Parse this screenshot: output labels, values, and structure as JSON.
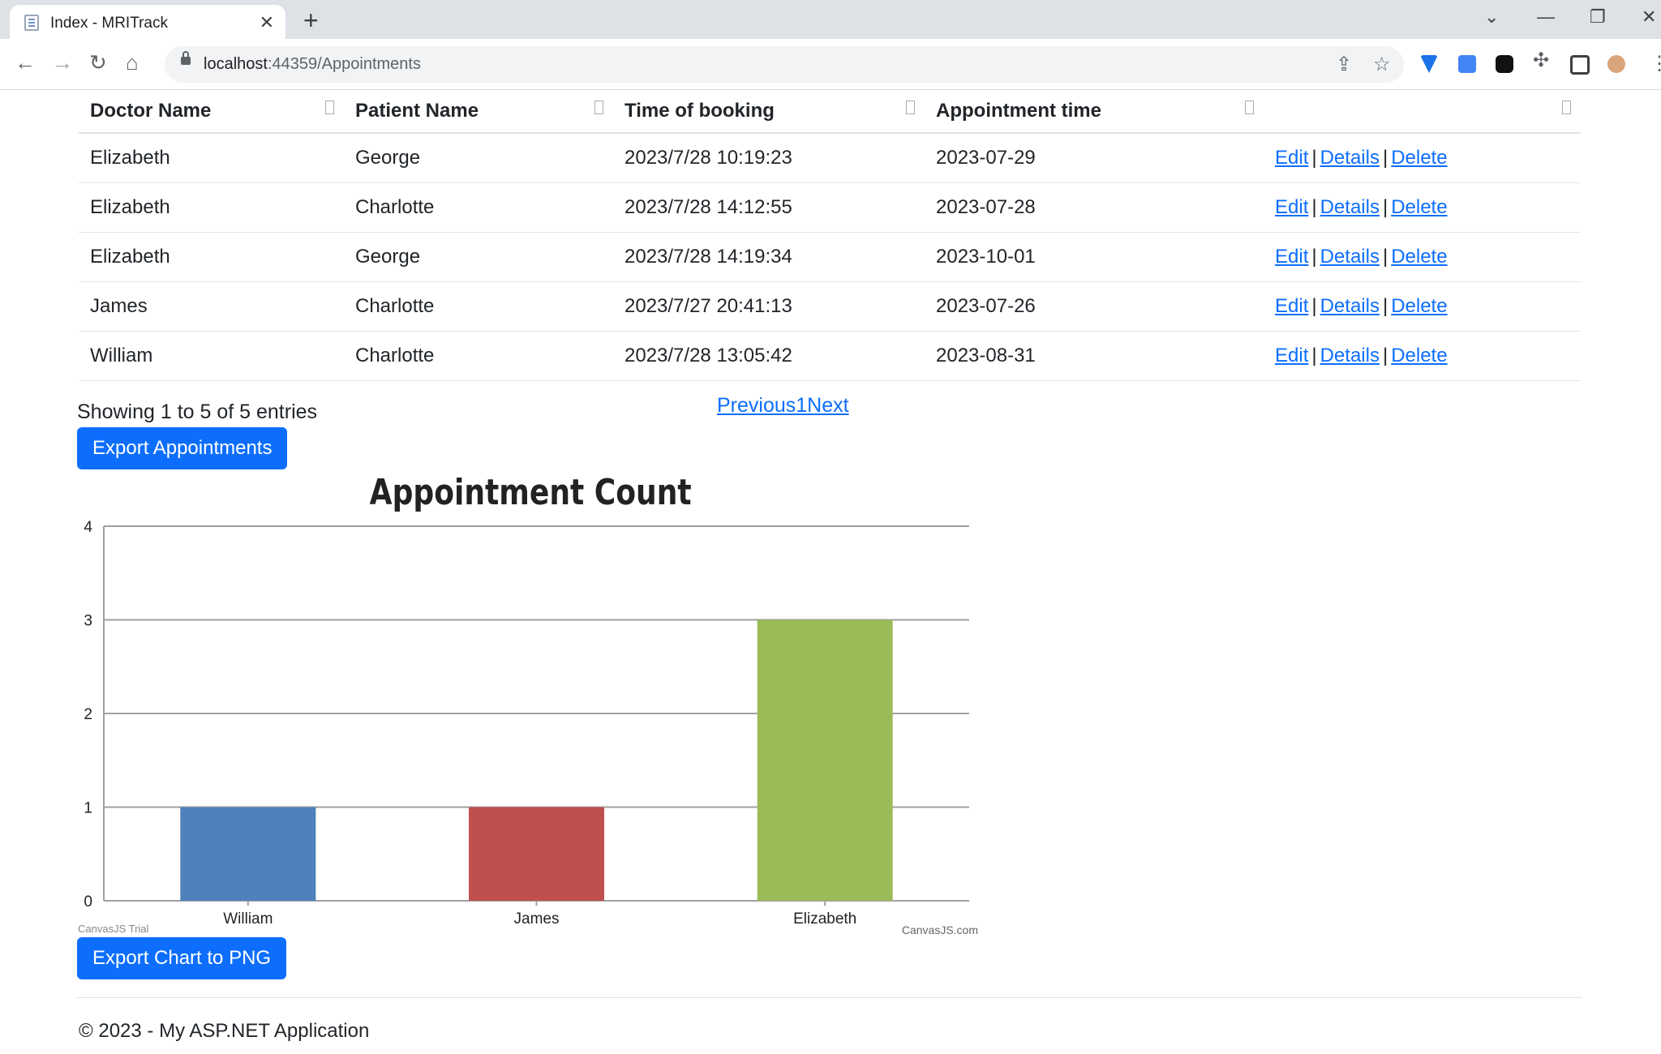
{
  "browser": {
    "tab_title": "Index - MRITrack",
    "url_host": "localhost",
    "url_rest": ":44359/Appointments"
  },
  "table": {
    "headers": [
      "Doctor Name",
      "Patient Name",
      "Time of booking",
      "Appointment time",
      ""
    ],
    "rows": [
      {
        "doctor": "Elizabeth",
        "patient": "George",
        "booked": "2023/7/28 10:19:23",
        "appt": "2023-07-29"
      },
      {
        "doctor": "Elizabeth",
        "patient": "Charlotte",
        "booked": "2023/7/28 14:12:55",
        "appt": "2023-07-28"
      },
      {
        "doctor": "Elizabeth",
        "patient": "George",
        "booked": "2023/7/28 14:19:34",
        "appt": "2023-10-01"
      },
      {
        "doctor": "James",
        "patient": "Charlotte",
        "booked": "2023/7/27 20:41:13",
        "appt": "2023-07-26"
      },
      {
        "doctor": "William",
        "patient": "Charlotte",
        "booked": "2023/7/28 13:05:42",
        "appt": "2023-08-31"
      }
    ],
    "actions": {
      "edit": "Edit",
      "details": "Details",
      "delete": "Delete",
      "separator": "|"
    }
  },
  "info_text": "Showing 1 to 5 of 5 entries",
  "pager": {
    "previous": "Previous",
    "page": "1",
    "next": "Next"
  },
  "export_appointments_label": "Export Appointments",
  "export_chart_label": "Export Chart to PNG",
  "chart_data": {
    "type": "bar",
    "title": "Appointment Count",
    "categories": [
      "William",
      "James",
      "Elizabeth"
    ],
    "values": [
      1,
      1,
      3
    ],
    "colors": [
      "#4f81bc",
      "#c0504e",
      "#9bbb58"
    ],
    "ylim": [
      0,
      4
    ],
    "yticks": [
      0,
      1,
      2,
      3,
      4
    ],
    "grid": true,
    "watermark_left": "CanvasJS Trial",
    "watermark_right": "CanvasJS.com"
  },
  "footer": "© 2023 - My ASP.NET Application"
}
